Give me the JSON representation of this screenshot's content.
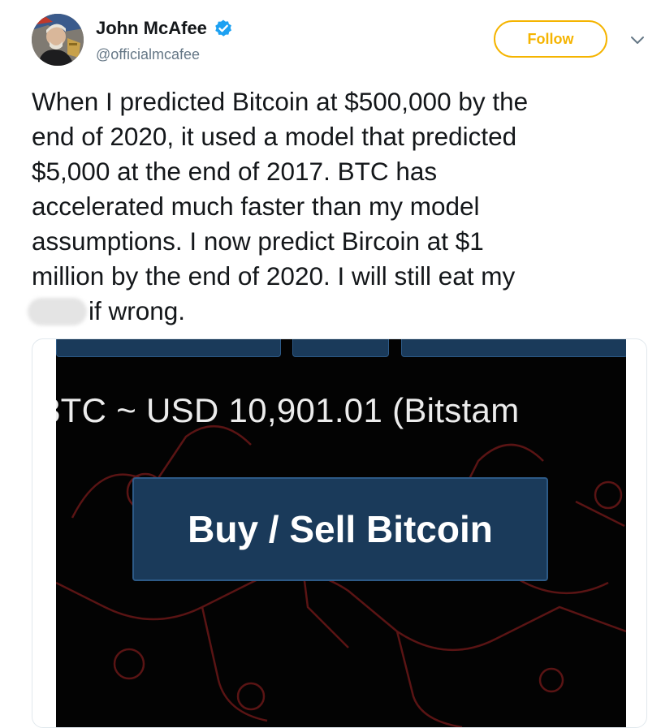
{
  "author": {
    "display_name": "John McAfee",
    "handle": "@officialmcafee",
    "verified_icon": "verified-badge-icon",
    "avatar_icon": "avatar"
  },
  "actions": {
    "follow_label": "Follow",
    "more_icon": "chevron-down-icon"
  },
  "tweet": {
    "text": "When I predicted Bitcoin at $500,000 by the\nend of 2020, it used a model that predicted\n$5,000 at the end of 2017. BTC has\naccelerated much faster than my model\nassumptions. I now predict Bircoin at $1\nmillion by the end of 2020. I will still eat my\n        if wrong."
  },
  "media": {
    "ticker_text": "3TC ~ USD 10,901.01 (Bitstam",
    "button_label": "Buy / Sell Bitcoin"
  },
  "colors": {
    "follow_accent": "#f5b400",
    "verified_blue": "#1da1f2",
    "media_button_bg": "#1a3a5a",
    "media_bg": "#030303"
  }
}
